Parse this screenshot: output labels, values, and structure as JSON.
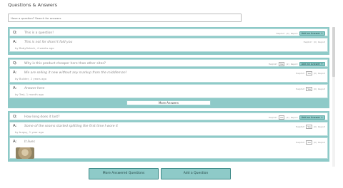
{
  "header": {
    "title": "Questions & Answers"
  },
  "search": {
    "placeholder": "Have a question? Search for answers"
  },
  "labels": {
    "q_prefix": "Q:",
    "a_prefix": "A:",
    "helpful": "Helpful?",
    "yes": "Yes",
    "report": "Report",
    "add_answer": "Add an Answer +",
    "more_answers": "More Answers"
  },
  "questions": [
    {
      "text": "This is a question!",
      "helpful_count": "(0)",
      "answers": [
        {
          "text": "This is not for sharn't fold you",
          "byline": "by Babyfishark, 4 weeks ago",
          "helpful_count": "(0)"
        }
      ]
    },
    {
      "text": "Why is this product cheaper here than other sites?",
      "helpful_count": "(2)",
      "answers": [
        {
          "text": "We are selling it new without any markup from the middleman!",
          "byline": "by Builder, 2 years ago",
          "helpful_count": "(0)"
        },
        {
          "text": "Answer here",
          "byline": "by Test, 1 month ago",
          "helpful_count": "(0)"
        }
      ],
      "show_more_answers": true
    },
    {
      "text": "How long does it last?",
      "helpful_count": "(2)",
      "answers": [
        {
          "text": "Some of the seams started splitting the first time I wore it",
          "byline": "by bugsy, 1 year ago",
          "helpful_count": "(0)"
        },
        {
          "text": "It lives",
          "byline": "",
          "helpful_count": "(0)",
          "has_photo": true
        }
      ]
    }
  ],
  "footer": {
    "more_questions": "More Answered Questions",
    "add_question": "Add a Question"
  },
  "colors": {
    "accent": "#8ecac8",
    "accent_border": "#3b8886"
  }
}
